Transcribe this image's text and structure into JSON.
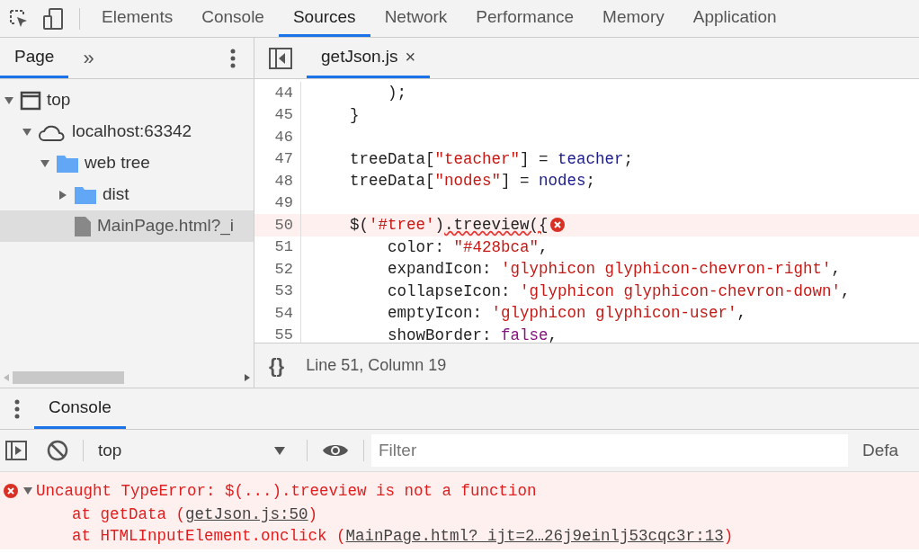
{
  "toolbar": {
    "main_tabs": [
      {
        "label": "Elements",
        "selected": false
      },
      {
        "label": "Console",
        "selected": false
      },
      {
        "label": "Sources",
        "selected": true
      },
      {
        "label": "Network",
        "selected": false
      },
      {
        "label": "Performance",
        "selected": false
      },
      {
        "label": "Memory",
        "selected": false
      },
      {
        "label": "Application",
        "selected": false
      }
    ]
  },
  "navigator": {
    "tabs": [
      {
        "label": "Page",
        "selected": true
      }
    ],
    "more": "»",
    "tree": [
      {
        "label": "top",
        "kind": "frame",
        "expanded": true,
        "selected": false,
        "children": [
          {
            "label": "localhost:63342",
            "kind": "cloud",
            "expanded": true,
            "selected": false,
            "children": [
              {
                "label": "web tree",
                "kind": "folder",
                "expanded": true,
                "selected": false,
                "children": [
                  {
                    "label": "dist",
                    "kind": "folder",
                    "expanded": false,
                    "selected": false
                  },
                  {
                    "label": "MainPage.html?_i",
                    "kind": "file",
                    "selected": true
                  }
                ]
              }
            ]
          }
        ]
      }
    ]
  },
  "editor": {
    "tabs": [
      {
        "label": "getJson.js",
        "selected": true,
        "close": "×"
      }
    ],
    "lines": [
      {
        "number": "44",
        "error": false,
        "tokens": [
          {
            "kind": "plain",
            "text": "        );"
          }
        ]
      },
      {
        "number": "45",
        "error": false,
        "tokens": [
          {
            "kind": "plain",
            "text": "    }"
          }
        ]
      },
      {
        "number": "46",
        "error": false
      },
      {
        "number": "47",
        "error": false,
        "tokens": [
          {
            "kind": "plain",
            "text": "    treeData["
          },
          {
            "kind": "string",
            "text": "\"teacher\""
          },
          {
            "kind": "plain",
            "text": "] = "
          },
          {
            "kind": "variable",
            "text": "teacher"
          },
          {
            "kind": "plain",
            "text": ";"
          }
        ]
      },
      {
        "number": "48",
        "error": false,
        "tokens": [
          {
            "kind": "plain",
            "text": "    treeData["
          },
          {
            "kind": "string",
            "text": "\"nodes\""
          },
          {
            "kind": "plain",
            "text": "] = "
          },
          {
            "kind": "variable",
            "text": "nodes"
          },
          {
            "kind": "plain",
            "text": ";"
          }
        ]
      },
      {
        "number": "49",
        "error": false
      },
      {
        "number": "50",
        "error": true,
        "tokens": [
          {
            "kind": "plain",
            "text": "    $("
          },
          {
            "kind": "string",
            "text": "'#tree'"
          },
          {
            "kind": "plain",
            "text": ")"
          },
          {
            "kind": "squiggle",
            "text": ".treeview({"
          }
        ]
      },
      {
        "number": "51",
        "error": false,
        "tokens": [
          {
            "kind": "plain",
            "text": "        color: "
          },
          {
            "kind": "string",
            "text": "\"#428bca\""
          },
          {
            "kind": "plain",
            "text": ","
          }
        ]
      },
      {
        "number": "52",
        "error": false,
        "tokens": [
          {
            "kind": "plain",
            "text": "        expandIcon: "
          },
          {
            "kind": "string",
            "text": "'glyphicon glyphicon-chevron-right'"
          },
          {
            "kind": "plain",
            "text": ","
          }
        ]
      },
      {
        "number": "53",
        "error": false,
        "tokens": [
          {
            "kind": "plain",
            "text": "        collapseIcon: "
          },
          {
            "kind": "string",
            "text": "'glyphicon glyphicon-chevron-down'"
          },
          {
            "kind": "plain",
            "text": ","
          }
        ]
      },
      {
        "number": "54",
        "error": false,
        "tokens": [
          {
            "kind": "plain",
            "text": "        emptyIcon: "
          },
          {
            "kind": "string",
            "text": "'glyphicon glyphicon-user'"
          },
          {
            "kind": "plain",
            "text": ","
          }
        ]
      },
      {
        "number": "55",
        "error": false,
        "tokens": [
          {
            "kind": "plain",
            "text": "        showBorder: "
          },
          {
            "kind": "keyword",
            "text": "false"
          },
          {
            "kind": "plain",
            "text": ","
          }
        ]
      }
    ],
    "status_bar": {
      "pretty_print": "{}",
      "position": "Line 51, Column 19"
    }
  },
  "drawer": {
    "tabs": [
      {
        "label": "Console",
        "selected": true
      }
    ],
    "context": "top",
    "filter": {
      "placeholder": "Filter"
    },
    "levels": "Defa",
    "messages": [
      {
        "kind": "error",
        "expanded": true,
        "text": "Uncaught TypeError: $(...).treeview is not a function",
        "stack": [
          {
            "prefix": "at getData (",
            "link": "getJson.js:50",
            "suffix": ")"
          },
          {
            "prefix": "at HTMLInputElement.onclick (",
            "link": "MainPage.html?_ijt=2…26j9einlj53cqc3r:13",
            "suffix": ")"
          }
        ]
      }
    ]
  }
}
